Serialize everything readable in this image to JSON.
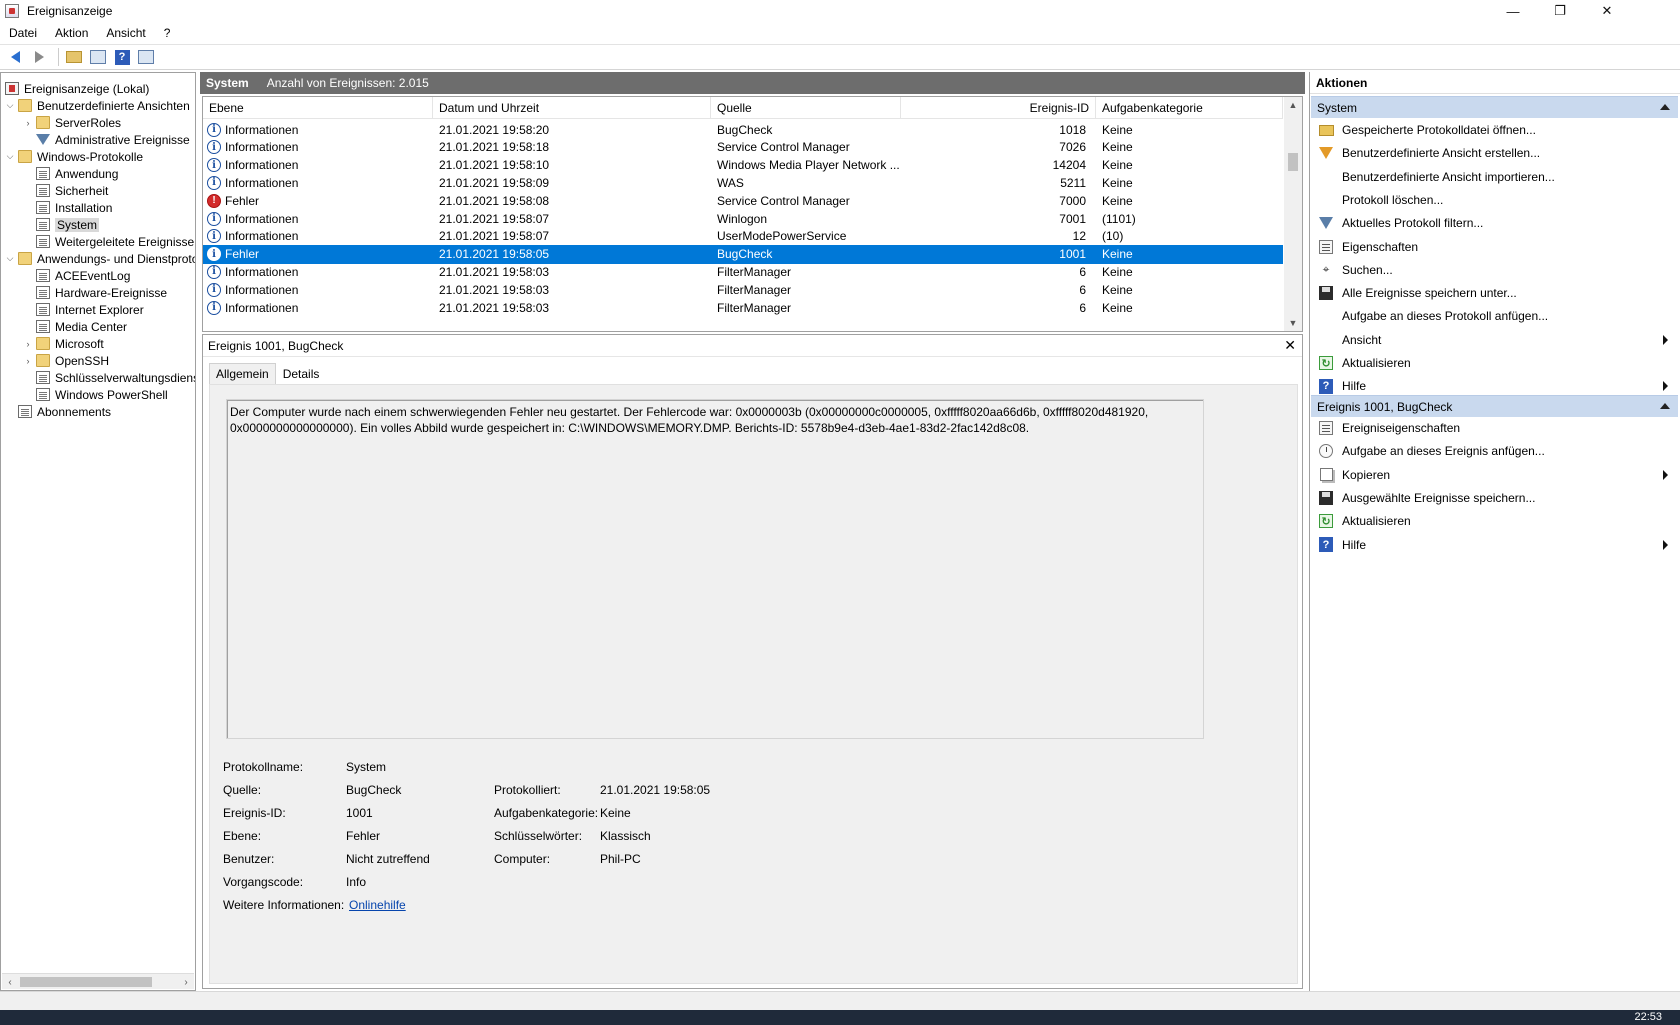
{
  "window": {
    "title": "Ereignisanzeige",
    "controls": {
      "minimize": "—",
      "restore": "❐",
      "close": "✕"
    }
  },
  "menu": [
    "Datei",
    "Aktion",
    "Ansicht",
    "?"
  ],
  "tree": {
    "root": "Ereignisanzeige (Lokal)",
    "custom_views": "Benutzerdefinierte Ansichten",
    "server_roles": "ServerRoles",
    "admin_events": "Administrative Ereignisse",
    "windows_logs": "Windows-Protokolle",
    "app": "Anwendung",
    "security": "Sicherheit",
    "setup": "Installation",
    "system": "System",
    "forwarded": "Weitergeleitete Ereignisse",
    "app_services": "Anwendungs- und Dienstprotokolle",
    "ace": "ACEEventLog",
    "hw": "Hardware-Ereignisse",
    "ie": "Internet Explorer",
    "mc": "Media Center",
    "ms": "Microsoft",
    "ssh": "OpenSSH",
    "keymgmt": "Schlüsselverwaltungsdienst",
    "ps": "Windows PowerShell",
    "subs": "Abonnements"
  },
  "log": {
    "name": "System",
    "count_label": "Anzahl von Ereignissen: 2.015",
    "columns": [
      "Ebene",
      "Datum und Uhrzeit",
      "Quelle",
      "Ereignis-ID",
      "Aufgabenkategorie"
    ],
    "rows": [
      {
        "level": "Informationen",
        "icon": "info",
        "date": "21.01.2021 19:58:20",
        "source": "BugCheck",
        "id": "1018",
        "task": "Keine"
      },
      {
        "level": "Informationen",
        "icon": "info",
        "date": "21.01.2021 19:58:18",
        "source": "Service Control Manager",
        "id": "7026",
        "task": "Keine"
      },
      {
        "level": "Informationen",
        "icon": "info",
        "date": "21.01.2021 19:58:10",
        "source": "Windows Media Player Network ...",
        "id": "14204",
        "task": "Keine"
      },
      {
        "level": "Informationen",
        "icon": "info",
        "date": "21.01.2021 19:58:09",
        "source": "WAS",
        "id": "5211",
        "task": "Keine"
      },
      {
        "level": "Fehler",
        "icon": "error",
        "date": "21.01.2021 19:58:08",
        "source": "Service Control Manager",
        "id": "7000",
        "task": "Keine"
      },
      {
        "level": "Informationen",
        "icon": "info",
        "date": "21.01.2021 19:58:07",
        "source": "Winlogon",
        "id": "7001",
        "task": "(1101)"
      },
      {
        "level": "Informationen",
        "icon": "info",
        "date": "21.01.2021 19:58:07",
        "source": "UserModePowerService",
        "id": "12",
        "task": "(10)"
      },
      {
        "level": "Fehler",
        "icon": "info",
        "date": "21.01.2021 19:58:05",
        "source": "BugCheck",
        "id": "1001",
        "task": "Keine"
      },
      {
        "level": "Informationen",
        "icon": "info",
        "date": "21.01.2021 19:58:03",
        "source": "FilterManager",
        "id": "6",
        "task": "Keine"
      },
      {
        "level": "Informationen",
        "icon": "info",
        "date": "21.01.2021 19:58:03",
        "source": "FilterManager",
        "id": "6",
        "task": "Keine"
      },
      {
        "level": "Informationen",
        "icon": "info",
        "date": "21.01.2021 19:58:03",
        "source": "FilterManager",
        "id": "6",
        "task": "Keine"
      }
    ],
    "selected_index": 7
  },
  "detail": {
    "title": "Ereignis 1001, BugCheck",
    "tabs": [
      "Allgemein",
      "Details"
    ],
    "message": "Der Computer wurde nach einem schwerwiegenden Fehler neu gestartet. Der Fehlercode war: 0x0000003b (0x00000000c0000005, 0xfffff8020aa66d6b, 0xfffff8020d481920, 0x0000000000000000). Ein volles Abbild wurde gespeichert in: C:\\WINDOWS\\MEMORY.DMP. Berichts-ID: 5578b9e4-d3eb-4ae1-83d2-2fac142d8c08.",
    "labels": {
      "logname": "Protokollname:",
      "source": "Quelle:",
      "eventid": "Ereignis-ID:",
      "level": "Ebene:",
      "user": "Benutzer:",
      "opcode": "Vorgangscode:",
      "moreinfo": "Weitere Informationen:",
      "logged": "Protokolliert:",
      "taskcat": "Aufgabenkategorie:",
      "keywords": "Schlüsselwörter:",
      "computer": "Computer:"
    },
    "values": {
      "logname": "System",
      "source": "BugCheck",
      "eventid": "1001",
      "level": "Fehler",
      "user": "Nicht zutreffend",
      "opcode": "Info",
      "moreinfo": "Onlinehilfe",
      "logged": "21.01.2021 19:58:05",
      "taskcat": "Keine",
      "keywords": "Klassisch",
      "computer": "Phil-PC"
    }
  },
  "actions": {
    "header": "Aktionen",
    "section1": "System",
    "items1": [
      {
        "label": "Gespeicherte Protokolldatei öffnen...",
        "icon": "folder-open-icon"
      },
      {
        "label": "Benutzerdefinierte Ansicht erstellen...",
        "icon": "funnel-icon"
      },
      {
        "label": "Benutzerdefinierte Ansicht importieren...",
        "icon": ""
      },
      {
        "label": "Protokoll löschen...",
        "icon": ""
      },
      {
        "label": "Aktuelles Protokoll filtern...",
        "icon": "filter-icon"
      },
      {
        "label": "Eigenschaften",
        "icon": "properties-icon"
      },
      {
        "label": "Suchen...",
        "icon": "binoculars-icon"
      },
      {
        "label": "Alle Ereignisse speichern unter...",
        "icon": "save-icon"
      },
      {
        "label": "Aufgabe an dieses Protokoll anfügen...",
        "icon": ""
      },
      {
        "label": "Ansicht",
        "icon": ""
      },
      {
        "label": "Aktualisieren",
        "icon": "refresh-icon"
      },
      {
        "label": "Hilfe",
        "icon": "help-icon"
      }
    ],
    "section2": "Ereignis 1001, BugCheck",
    "items2": [
      {
        "label": "Ereigniseigenschaften",
        "icon": "properties-icon"
      },
      {
        "label": "Aufgabe an dieses Ereignis anfügen...",
        "icon": "task-icon"
      },
      {
        "label": "Kopieren",
        "icon": "copy-icon"
      },
      {
        "label": "Ausgewählte Ereignisse speichern...",
        "icon": "save-icon"
      },
      {
        "label": "Aktualisieren",
        "icon": "refresh-icon"
      },
      {
        "label": "Hilfe",
        "icon": "help-icon"
      }
    ]
  },
  "taskbar": {
    "clock": "22:53"
  }
}
